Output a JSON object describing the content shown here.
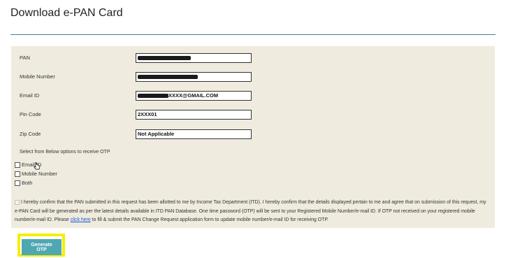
{
  "page": {
    "title": "Download e-PAN Card"
  },
  "form": {
    "pan": {
      "label": "PAN",
      "value": ""
    },
    "mobile": {
      "label": "Mobile Number",
      "value": ""
    },
    "email": {
      "label": "Email ID",
      "value": "XXXX@GMAIL.COM"
    },
    "pin": {
      "label": "Pin Code",
      "value": "2XXX01"
    },
    "zip": {
      "label": "Zip Code",
      "value": "Not Applicable"
    }
  },
  "otp_options": {
    "heading": "Select from Below options to receive OTP",
    "items": [
      {
        "label": "Email ID",
        "checked": false
      },
      {
        "label": "Mobile Number",
        "checked": false
      },
      {
        "label": "Both",
        "checked": false
      }
    ]
  },
  "confirmation": {
    "text_before_link": "I hereby confirm that the PAN submitted in this request has been allotted to me by Income Tax Department (ITD). I hereby confirm that the details displayed pertain to me and agree that on submission of this request, my e-PAN Card will be generated as per the latest details available in ITD PAN Database. One time password (OTP) will be sent to your Registered Mobile Number/e-mail ID. If OTP not received on your registered mobile number/e-mail ID. Please ",
    "link_text": "click here",
    "text_after_link": " to fill & submit the PAN Change Request application form to update mobile number/e-mail ID for receiving OTP.",
    "checked": false
  },
  "actions": {
    "generate_otp": "Generate OTP"
  },
  "colors": {
    "panel_bg": "#efebde",
    "rule": "#3a8a87",
    "button": "#4fa7b2",
    "highlight": "#f4f000",
    "link": "#1a56d6"
  }
}
